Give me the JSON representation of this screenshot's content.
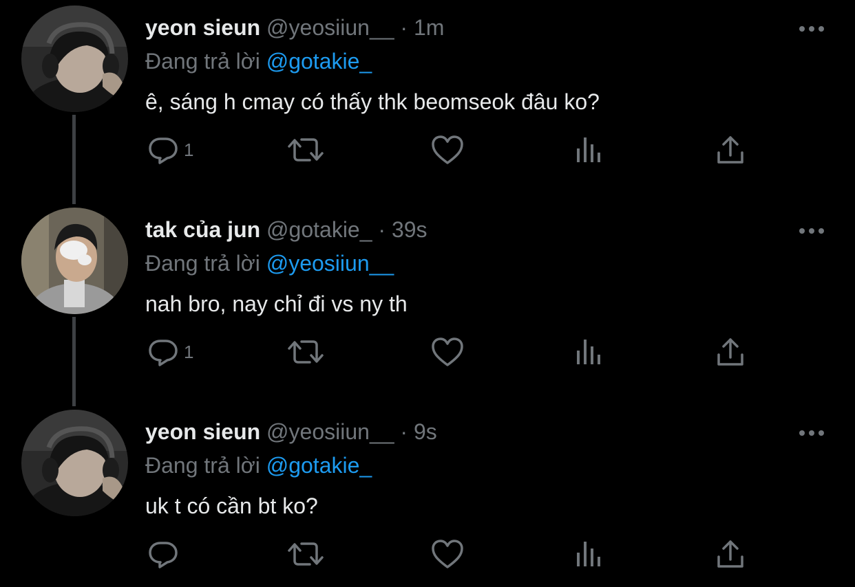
{
  "thread": [
    {
      "display_name": "yeon sieun",
      "handle": "@yeosiiun__",
      "separator": "·",
      "time": "1m",
      "reply_prefix": "Đang trả lời",
      "reply_handle": "@gotakie_",
      "text": "ê, sáng h cmay có thấy thk beomseok đâu ko?",
      "actions": {
        "reply_count": "1"
      }
    },
    {
      "display_name": "tak của jun",
      "handle": "@gotakie_",
      "separator": "·",
      "time": "39s",
      "reply_prefix": "Đang trả lời",
      "reply_handle": "@yeosiiun__",
      "text": "nah bro, nay chỉ đi vs ny th",
      "actions": {
        "reply_count": "1"
      }
    },
    {
      "display_name": "yeon sieun",
      "handle": "@yeosiiun__",
      "separator": "·",
      "time": "9s",
      "reply_prefix": "Đang trả lời",
      "reply_handle": "@gotakie_",
      "text": "uk t có cần bt ko?",
      "actions": {
        "reply_count": ""
      }
    }
  ],
  "icons": {
    "more": "more-options-icon",
    "reply": "reply-icon",
    "retweet": "retweet-icon",
    "like": "like-icon",
    "views": "views-icon",
    "share": "share-icon"
  },
  "colors": {
    "background": "#000000",
    "text_primary": "#e7e9ea",
    "text_secondary": "#71767b",
    "accent": "#1d9bf0",
    "thread_line": "#3e4144"
  }
}
